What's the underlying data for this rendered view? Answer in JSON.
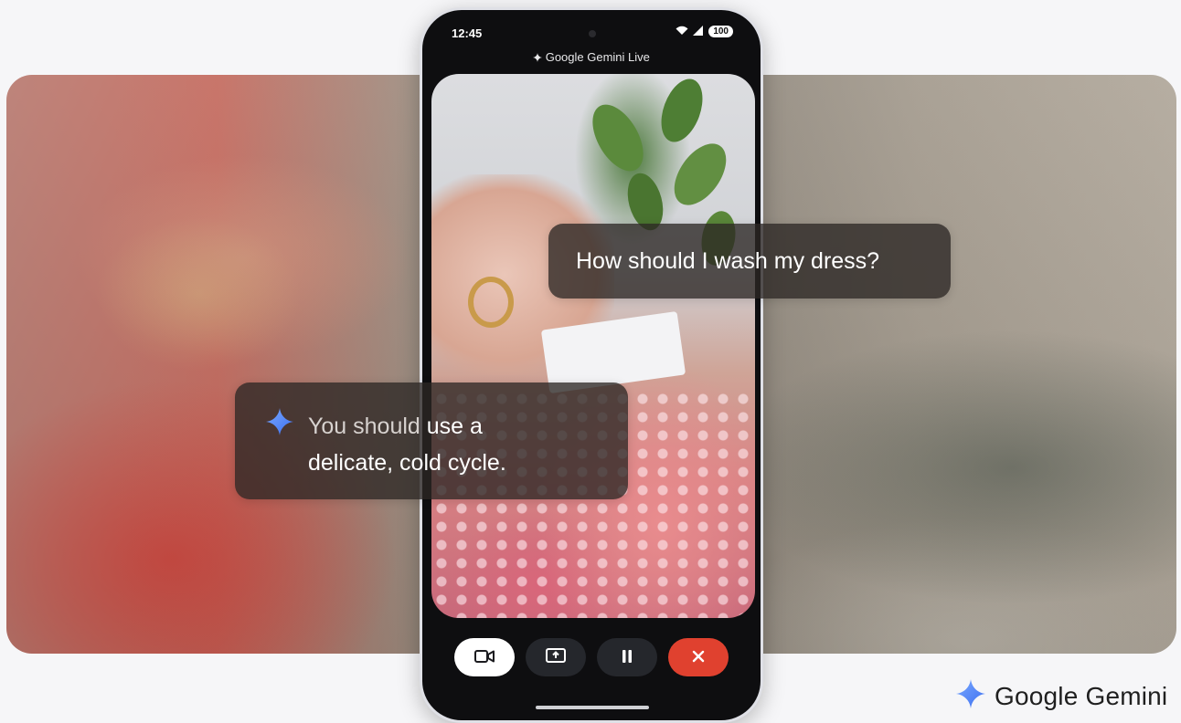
{
  "phone": {
    "status": {
      "time": "12:45",
      "battery": "100"
    },
    "app_title": "Google Gemini Live",
    "controls": [
      {
        "name": "camera-toggle",
        "icon": "video-camera-icon"
      },
      {
        "name": "screen-share",
        "icon": "screen-share-icon"
      },
      {
        "name": "pause",
        "icon": "pause-icon"
      },
      {
        "name": "end-call",
        "icon": "close-icon"
      }
    ]
  },
  "conversation": {
    "user_message": "How should I wash my dress?",
    "assistant_message": {
      "line1_dim": "You should ",
      "line1_strong": "use a",
      "line2": "delicate, cold cycle."
    }
  },
  "brand": {
    "name": "Google Gemini"
  },
  "colors": {
    "end_call": "#e0412f",
    "gemini_blue": "#4a86f7",
    "bubble_bg": "#2c2624"
  }
}
